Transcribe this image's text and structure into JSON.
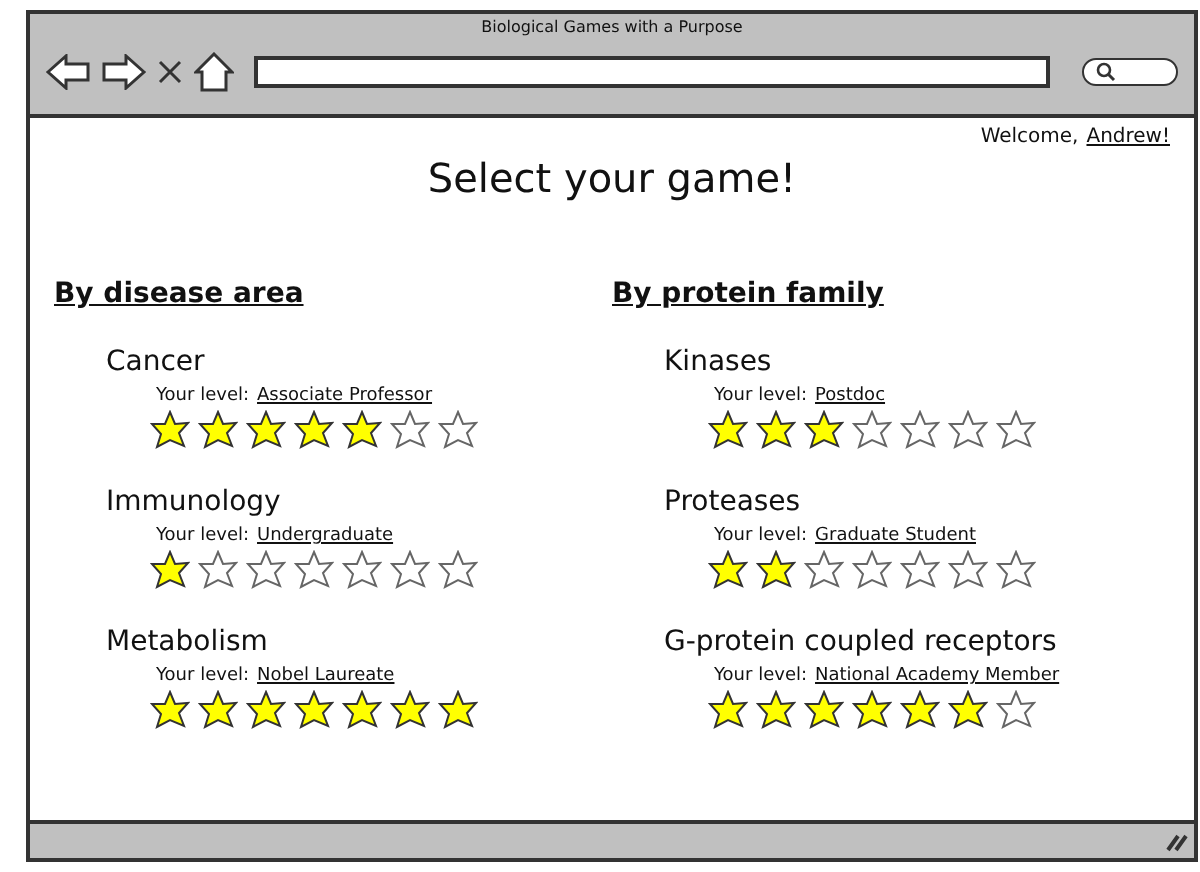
{
  "window": {
    "title": "Biological Games with a Purpose"
  },
  "welcome": {
    "text": "Welcome,",
    "user": "Andrew!"
  },
  "heading": "Select your game!",
  "sections": [
    {
      "title": "By disease area",
      "games": [
        {
          "name": "Cancer",
          "level_label": "Your level:",
          "level": "Associate Professor",
          "stars": 5
        },
        {
          "name": "Immunology",
          "level_label": "Your level:",
          "level": "Undergraduate",
          "stars": 1
        },
        {
          "name": "Metabolism",
          "level_label": "Your level:",
          "level": "Nobel Laureate",
          "stars": 7
        }
      ]
    },
    {
      "title": "By protein family",
      "games": [
        {
          "name": "Kinases",
          "level_label": "Your level:",
          "level": "Postdoc",
          "stars": 3
        },
        {
          "name": "Proteases",
          "level_label": "Your level:",
          "level": "Graduate Student",
          "stars": 2
        },
        {
          "name": "G-protein coupled receptors",
          "level_label": "Your level:",
          "level": "National Academy Member",
          "stars": 6
        }
      ]
    }
  ]
}
